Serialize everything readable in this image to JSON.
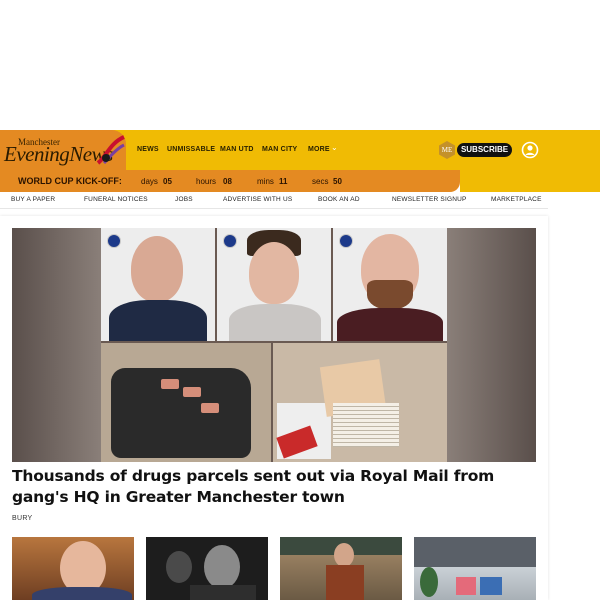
{
  "brand": {
    "logo_small": "Manchester",
    "logo_big": "EveningNews",
    "colors": {
      "header": "#f0bb04",
      "accent": "#e48a22"
    }
  },
  "header": {
    "nav": [
      "NEWS",
      "UNMISSABLE",
      "MAN UTD",
      "MAN CITY",
      "MORE"
    ],
    "more_icon": "chevron-down-icon",
    "subscribe_label": "SUBSCRIBE",
    "account_icon": "user-circle-icon"
  },
  "countdown": {
    "title": "WORLD CUP KICK-OFF:",
    "days_label": "days",
    "days": "05",
    "hours_label": "hours",
    "hours": "08",
    "mins_label": "mins",
    "mins": "11",
    "secs_label": "secs",
    "secs": "50"
  },
  "subnav": [
    "BUY A PAPER",
    "FUNERAL NOTICES",
    "JOBS",
    "ADVERTISE WITH US",
    "BOOK AN AD",
    "NEWSLETTER SIGNUP",
    "MARKETPLACE"
  ],
  "article": {
    "headline": "Thousands of drugs parcels sent out via Royal Mail from gang's HQ in Greater Manchester town",
    "tag": "BURY"
  }
}
